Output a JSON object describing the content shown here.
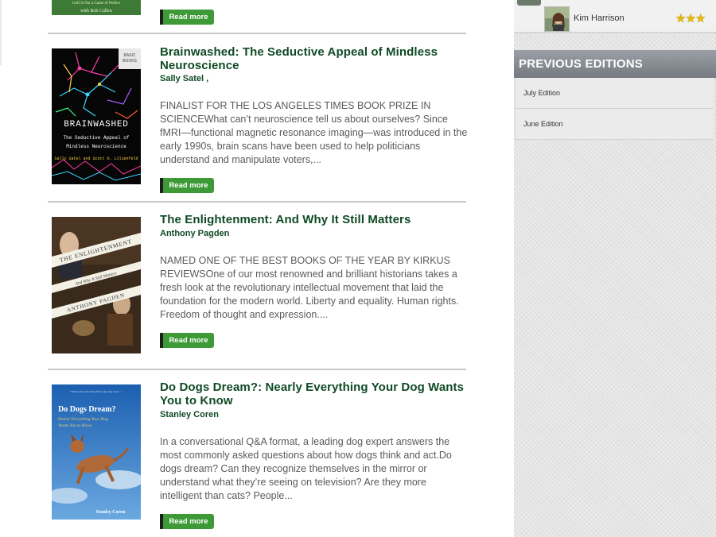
{
  "books": [
    {
      "title": "Brainwashed: The Seductive Appeal of Mindless Neuroscience",
      "author": "Sally Satel ,",
      "description": "FINALIST FOR THE LOS ANGELES TIMES BOOK PRIZE IN SCIENCEWhat can’t neuroscience tell us about ourselves? Since fMRI—functional magnetic resonance imaging—was introduced in the early 1990s, brain scans have been used to help politicians understand and manipulate voters,...",
      "read_more": "Read more",
      "cover_title": "BRAINWASHED",
      "cover_subtitle_1": "The Seductive Appeal of",
      "cover_subtitle_2": "Mindless Neuroscience",
      "cover_authors": "Sally Satel and Scott O. Lilienfeld"
    },
    {
      "title": "The Enlightenment: And Why It Still Matters",
      "author": "Anthony Pagden",
      "description": "NAMED ONE OF THE BEST BOOKS OF THE YEAR BY KIRKUS REVIEWSOne of our most renowned and brilliant historians takes a fresh look at the revolutionary intellectual movement that laid the foundation for the modern world.   Liberty and equality. Human rights. Freedom of thought and expression....",
      "read_more": "Read more",
      "cover_title": "THE ENLIGHTENMENT",
      "cover_subtitle": "And Why It Still Matters",
      "cover_author": "ANTHONY PAGDEN"
    },
    {
      "title": "Do Dogs Dream?: Nearly Everything Your Dog Wants You to Know",
      "author": "Stanley Coren",
      "description": "In a conversational Q&A format, a leading dog expert answers the most commonly asked questions about how dogs think and act.Do dogs dream? Can they recognize themselves in the mirror or understand what they’re seeing on television? Are they more intelligent than cats? People...",
      "read_more": "Read more",
      "cover_title": "Do Dogs Dream?",
      "cover_subtitle_1": "Nearly Everything Your Dog",
      "cover_subtitle_2": "Wants You to Know",
      "cover_author": "Stanley Coren"
    }
  ],
  "top_partial": {
    "read_more": "Read more",
    "cover_text_1": "Golf Is Not a Game of Perfect",
    "cover_text_2": "with Bob Cullen"
  },
  "sidebar": {
    "reviewer": {
      "name": "Kim Harrison",
      "rating": 3,
      "stars": "★★★"
    },
    "previous_editions": {
      "heading": "PREVIOUS EDITIONS",
      "items": [
        "July Edition",
        "June Edition"
      ]
    }
  },
  "colors": {
    "title_green": "#0f4a24",
    "button_green": "#3e9a37",
    "sidebar_header": "#747a80"
  }
}
